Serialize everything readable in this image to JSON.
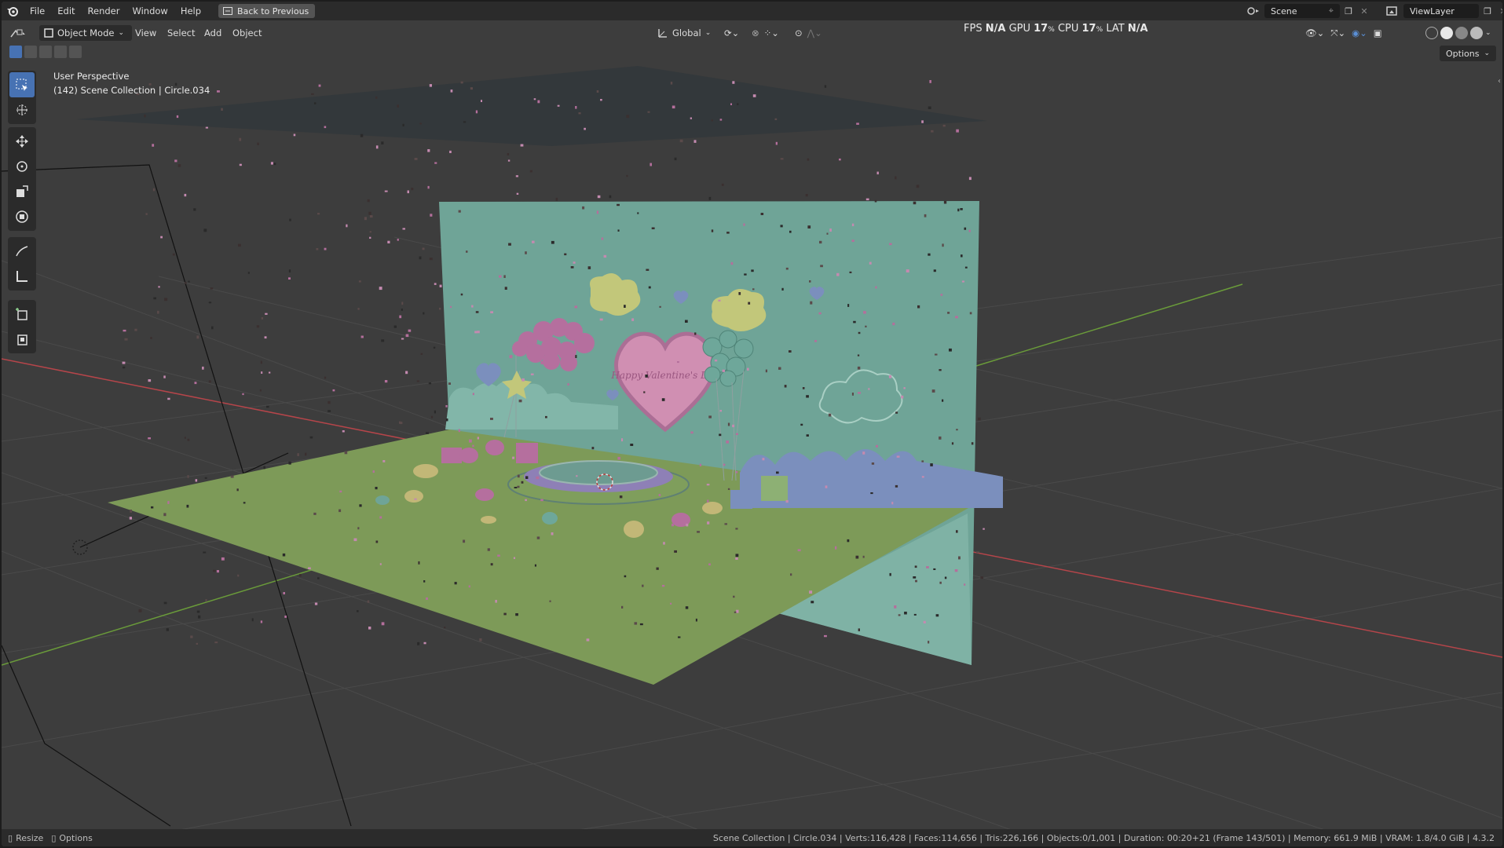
{
  "menu": {
    "items": [
      "File",
      "Edit",
      "Render",
      "Window",
      "Help"
    ],
    "back_button": "Back to Previous"
  },
  "scene_selector": {
    "value": "Scene"
  },
  "view_layer_selector": {
    "value": "ViewLayer"
  },
  "header": {
    "mode": "Object Mode",
    "view": "View",
    "select": "Select",
    "add": "Add",
    "object": "Object",
    "transform_orientation": "Global",
    "options": "Options"
  },
  "perf": {
    "fps_label": "FPS",
    "fps_value": "N/A",
    "gpu_label": "GPU",
    "gpu_value": "17",
    "cpu_label": "CPU",
    "cpu_value": "17",
    "percent": "%",
    "lat_label": "LAT",
    "lat_value": "N/A"
  },
  "viewport": {
    "perspective": "User Perspective",
    "collection_info": "(142) Scene Collection | Circle.034",
    "heart_text": "Happy Valentine's Day"
  },
  "statusbar": {
    "resize": "Resize",
    "options": "Options",
    "info": "Scene Collection | Circle.034 | Verts:116,428 | Faces:114,656 | Tris:226,166 | Objects:0/1,001 | Duration: 00:20+21 (Frame 143/501) | Memory: 661.9 MiB | VRAM: 1.8/4.0 GiB | 4.3.2"
  },
  "icons": [
    "blender-logo",
    "editor-type-icon",
    "object-mode-icon",
    "transform-orientation-icon",
    "pivot-icon",
    "snap-icon",
    "proportional-icon",
    "visibility-icon",
    "gizmo-icon",
    "overlay-icon",
    "xray-icon",
    "shading-wire-icon",
    "shading-solid-icon",
    "shading-material-icon",
    "shading-rendered-icon",
    "select-box-icon",
    "cursor-icon",
    "move-icon",
    "rotate-icon",
    "scale-icon",
    "transform-icon",
    "annotate-icon",
    "measure-icon",
    "add-cube-icon",
    "add-object-icon",
    "camera-icon"
  ],
  "colors": {
    "accent": "#4772b3",
    "background_wall": "#6fa497",
    "floor": "#7d9a58",
    "axis_red": "#b5454a",
    "axis_green": "#6a9b3a"
  }
}
